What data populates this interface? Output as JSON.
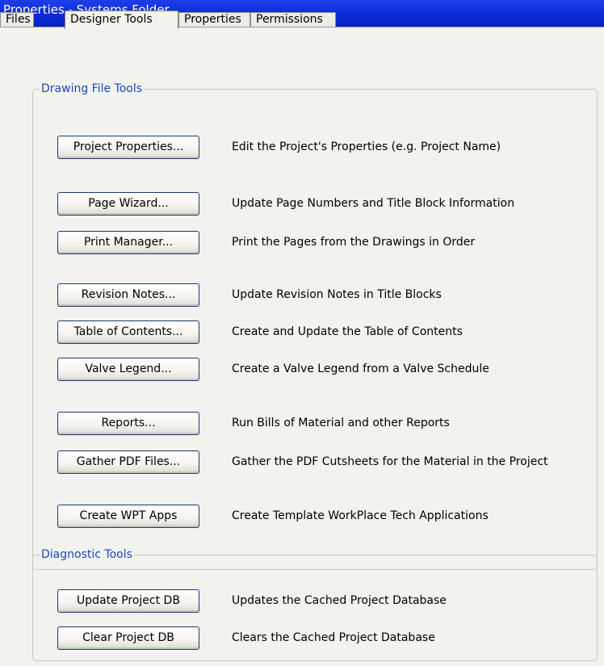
{
  "window": {
    "title": "Properties - Systems Folder"
  },
  "tabs": [
    {
      "label": "Files"
    },
    {
      "label": "Designer Tools"
    },
    {
      "label": "Properties"
    },
    {
      "label": "Permissions"
    }
  ],
  "drawing_tools": {
    "legend": "Drawing File Tools",
    "items": [
      {
        "button": "Project Properties...",
        "description": "Edit the Project's Properties (e.g. Project Name)"
      },
      {
        "button": "Page Wizard...",
        "description": "Update Page Numbers and Title Block Information"
      },
      {
        "button": "Print Manager...",
        "description": "Print the Pages from the Drawings in Order"
      },
      {
        "button": "Revision Notes...",
        "description": "Update Revision Notes in Title Blocks"
      },
      {
        "button": "Table of Contents...",
        "description": "Create and Update the Table of Contents"
      },
      {
        "button": "Valve Legend...",
        "description": "Create a Valve Legend from a Valve Schedule"
      },
      {
        "button": "Reports...",
        "description": "Run Bills of Material and other Reports"
      },
      {
        "button": "Gather PDF Files...",
        "description": "Gather the PDF Cutsheets for the Material in the Project"
      },
      {
        "button": "Create WPT Apps",
        "description": "Create Template WorkPlace Tech Applications"
      }
    ]
  },
  "diagnostic_tools": {
    "legend": "Diagnostic Tools",
    "items": [
      {
        "button": "Update Project DB",
        "description": "Updates the Cached Project Database"
      },
      {
        "button": "Clear Project DB",
        "description": "Clears the Cached Project Database"
      }
    ]
  }
}
